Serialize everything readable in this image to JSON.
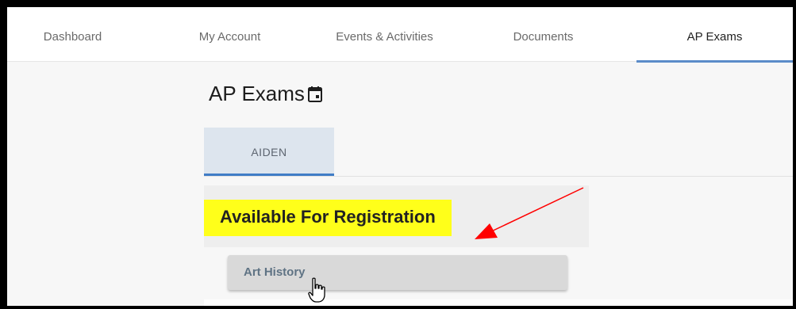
{
  "nav": {
    "items": [
      {
        "label": "Dashboard",
        "active": false
      },
      {
        "label": "My Account",
        "active": false
      },
      {
        "label": "Events & Activities",
        "active": false
      },
      {
        "label": "Documents",
        "active": false
      },
      {
        "label": "AP Exams",
        "active": true
      }
    ],
    "accent_color": "#5b8cc9"
  },
  "main": {
    "title": "AP Exams",
    "title_icon": "calendar-icon",
    "student_tab": {
      "label": "AIDEN",
      "selected": true
    },
    "section": {
      "heading": "Available For Registration",
      "highlight_color": "#ffff1a"
    },
    "exams": [
      {
        "label": "Art History"
      }
    ]
  },
  "annotation": {
    "arrow_color": "#ff0000",
    "icon": "red-arrow-annotation"
  },
  "cursor": {
    "icon": "hand-pointer-icon"
  }
}
